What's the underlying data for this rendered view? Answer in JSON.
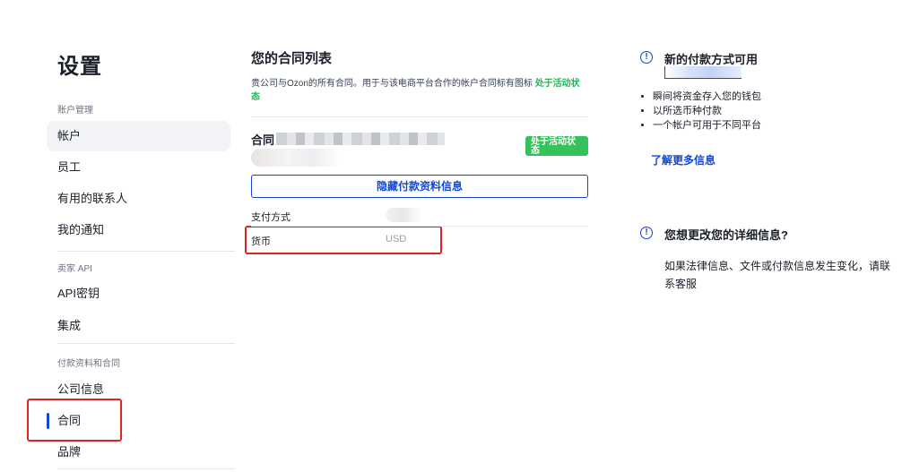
{
  "sidebar": {
    "title": "设置",
    "sections": {
      "account": "账户管理",
      "seller_api": "卖家 API",
      "payment": "付款资料和合同"
    },
    "items": {
      "account": "帐户",
      "staff": "员工",
      "contacts": "有用的联系人",
      "notifications": "我的通知",
      "api_keys": "API密钥",
      "integration": "集成",
      "company_info": "公司信息",
      "contracts": "合同",
      "brands": "品牌"
    }
  },
  "main": {
    "title": "您的合同列表",
    "description": "贵公司与Ozon的所有合同。用于与该电商平台合作的帐户合同标有图标",
    "description_highlight": "处于活动状态",
    "contract_label": "合同",
    "badge": "处于活动状态",
    "hide_button": "隐藏付款资料信息",
    "rows": [
      {
        "label": "支付方式",
        "value": ""
      },
      {
        "label": "货币",
        "value": "USD"
      }
    ]
  },
  "right": {
    "card1": {
      "title": "新的付款方式可用",
      "bullets": [
        "瞬间将资金存入您的钱包",
        "以所选币种付款",
        "一个帐户可用于不同平台"
      ],
      "link": "了解更多信息"
    },
    "card2": {
      "title": "您想更改您的详细信息?",
      "text": "如果法律信息、文件或付款信息发生变化，请联系客服"
    }
  },
  "colors": {
    "accent": "#1447d6",
    "active_green": "#36c25a",
    "highlight_red": "#e0241b"
  }
}
